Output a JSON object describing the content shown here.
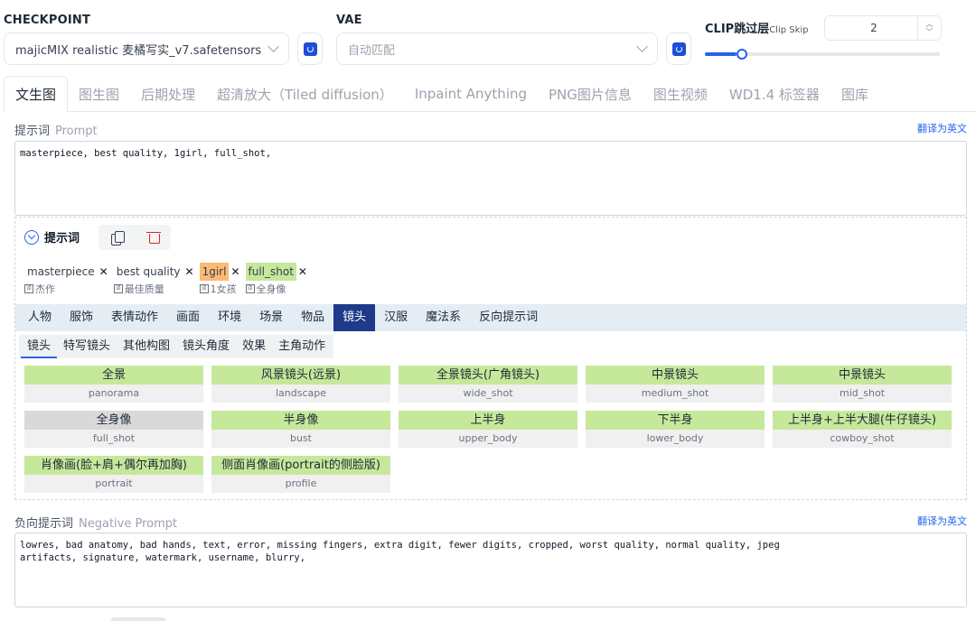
{
  "checkpoint": {
    "label": "CHECKPOINT",
    "value": "majicMIX realistic 麦橘写实_v7.safetensors"
  },
  "vae": {
    "label": "VAE",
    "value": "自动匹配"
  },
  "clip_skip": {
    "label": "CLIP跳过层",
    "label_en": "Clip Skip",
    "value": "2",
    "slider_fraction": 0.08
  },
  "main_tabs": [
    "文生图",
    "图生图",
    "后期处理",
    "超清放大（Tiled diffusion）",
    "Inpaint Anything",
    "PNG图片信息",
    "图生视频",
    "WD1.4 标签器",
    "图库"
  ],
  "prompt": {
    "label": "提示词",
    "label_en": "Prompt",
    "translate": "翻译为英文",
    "text": "masterpiece, best quality, 1girl, full_shot,"
  },
  "helper": {
    "title": "提示词",
    "tags": [
      {
        "en": "masterpiece",
        "zh": "杰作",
        "style": "plain"
      },
      {
        "en": "best quality",
        "zh": "最佳质量",
        "style": "plain"
      },
      {
        "en": "1girl",
        "zh": "1女孩",
        "style": "orange"
      },
      {
        "en": "full_shot",
        "zh": "全身像",
        "style": "green"
      }
    ],
    "categories": [
      "人物",
      "服饰",
      "表情动作",
      "画面",
      "环境",
      "场景",
      "物品",
      "镜头",
      "汉服",
      "魔法系",
      "反向提示词"
    ],
    "active_category": "镜头",
    "subcategories": [
      "镜头",
      "特写镜头",
      "其他构图",
      "镜头角度",
      "效果",
      "主角动作"
    ],
    "active_subcategory": "镜头",
    "cards": [
      {
        "zh": "全景",
        "en": "panorama"
      },
      {
        "zh": "风景镜头(远景)",
        "en": "landscape"
      },
      {
        "zh": "全景镜头(广角镜头)",
        "en": "wide_shot"
      },
      {
        "zh": "中景镜头",
        "en": "medium_shot"
      },
      {
        "zh": "中景镜头",
        "en": "mid_shot"
      },
      {
        "zh": "全身像",
        "en": "full_shot",
        "selected": true
      },
      {
        "zh": "半身像",
        "en": "bust"
      },
      {
        "zh": "上半身",
        "en": "upper_body"
      },
      {
        "zh": "下半身",
        "en": "lower_body"
      },
      {
        "zh": "上半身+上半大腿(牛仔镜头)",
        "en": "cowboy_shot"
      },
      {
        "zh": "肖像画(脸+肩+偶尔再加胸)",
        "en": "portrait"
      },
      {
        "zh": "侧面肖像画(portrait的侧脸版)",
        "en": "profile"
      }
    ]
  },
  "negative_prompt": {
    "label": "负向提示词",
    "label_en": "Negative Prompt",
    "translate": "翻译为英文",
    "text": "lowres, bad anatomy, bad hands, text, error, missing fingers, extra digit, fewer digits, cropped, worst quality, normal quality, jpeg\nartifacts, signature, watermark, username, blurry,"
  },
  "colors": {
    "accent": "#2563eb",
    "active_category": "#1e3a8a",
    "card_green": "#c6e89b",
    "tag_orange": "#fdba74"
  }
}
